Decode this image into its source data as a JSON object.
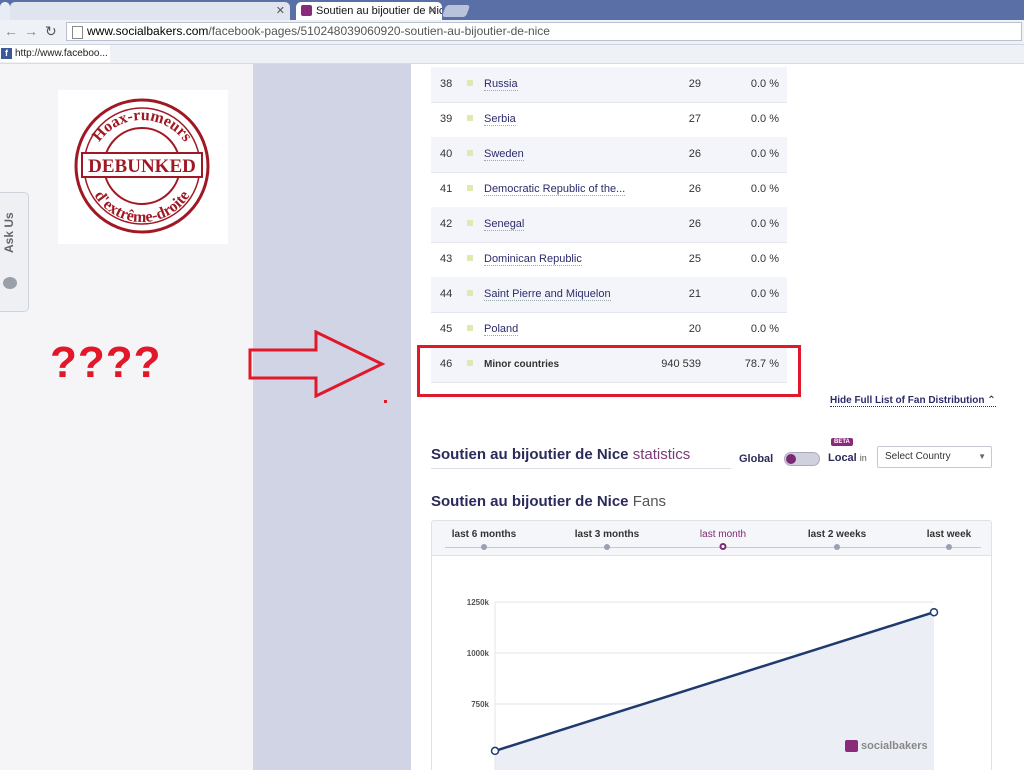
{
  "browser": {
    "tabs": [
      {
        "label": ""
      },
      {
        "label": "Soutien au bijoutier de Nic"
      }
    ],
    "url_host": "www.socialbakers.com",
    "url_path": "/facebook-pages/510248039060920-soutien-au-bijoutier-de-nice",
    "bookmark_label": "http://www.faceboo..."
  },
  "sidebar": {
    "ask_us_label": "Ask Us"
  },
  "stamp": {
    "text_top": "Hoax-rumeurs",
    "text_center": "DEBUNKED",
    "text_bottom": "d'extrême-droite"
  },
  "annotation": {
    "question_marks": "????"
  },
  "fan_table": {
    "rows": [
      {
        "rank": "38",
        "country": "Russia",
        "fans": "29",
        "pct": "0.0 %"
      },
      {
        "rank": "39",
        "country": "Serbia",
        "fans": "27",
        "pct": "0.0 %"
      },
      {
        "rank": "40",
        "country": "Sweden",
        "fans": "26",
        "pct": "0.0 %"
      },
      {
        "rank": "41",
        "country": "Democratic Republic of the...",
        "fans": "26",
        "pct": "0.0 %"
      },
      {
        "rank": "42",
        "country": "Senegal",
        "fans": "26",
        "pct": "0.0 %"
      },
      {
        "rank": "43",
        "country": "Dominican Republic",
        "fans": "25",
        "pct": "0.0 %"
      },
      {
        "rank": "44",
        "country": "Saint Pierre and Miquelon",
        "fans": "21",
        "pct": "0.0 %"
      },
      {
        "rank": "45",
        "country": "Poland",
        "fans": "20",
        "pct": "0.0 %"
      },
      {
        "rank": "46",
        "country": "Minor countries",
        "fans": "940 539",
        "pct": "78.7 %"
      }
    ],
    "hide_link": "Hide Full List of Fan Distribution ⌃"
  },
  "stats": {
    "page_name": "Soutien au bijoutier de Nice",
    "suffix": "statistics",
    "global_label": "Global",
    "beta_badge": "BETA",
    "local_label": "Local",
    "local_in": "in",
    "country_select_value": "Select Country",
    "fans_suffix": "Fans"
  },
  "range_tabs": [
    {
      "label": "last 6 months",
      "active": false
    },
    {
      "label": "last 3 months",
      "active": false
    },
    {
      "label": "last month",
      "active": true
    },
    {
      "label": "last 2 weeks",
      "active": false
    },
    {
      "label": "last week",
      "active": false
    }
  ],
  "brand": {
    "logo_text": "socialbakers",
    "accent": "#7a2a72",
    "line_color": "#1f3a6e",
    "highlight_red": "#e0182a"
  },
  "chart_data": {
    "type": "area",
    "series": [
      {
        "values": [
          520000,
          1200000
        ]
      }
    ],
    "y_ticks": [
      "750k",
      "1000k",
      "1250k"
    ],
    "ylim": [
      500000,
      1250000
    ],
    "grid": true
  }
}
